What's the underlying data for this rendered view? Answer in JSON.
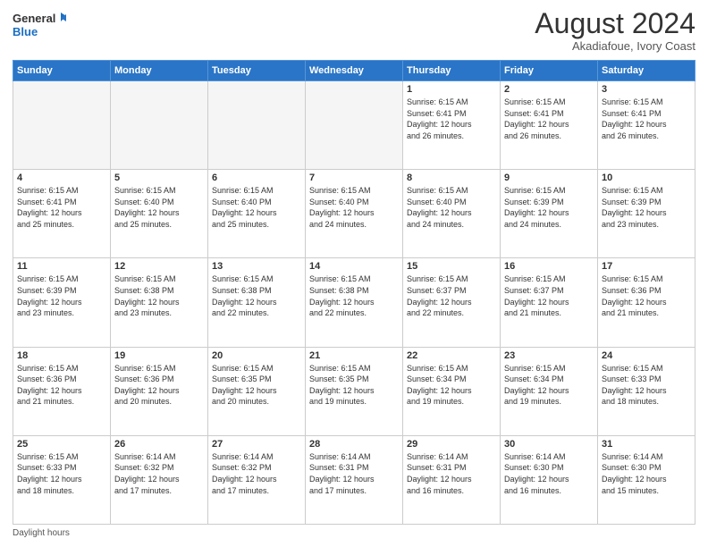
{
  "logo": {
    "line1": "General",
    "line2": "Blue"
  },
  "title": "August 2024",
  "location": "Akadiafoue, Ivory Coast",
  "weekdays": [
    "Sunday",
    "Monday",
    "Tuesday",
    "Wednesday",
    "Thursday",
    "Friday",
    "Saturday"
  ],
  "footer": "Daylight hours",
  "weeks": [
    [
      {
        "day": "",
        "info": ""
      },
      {
        "day": "",
        "info": ""
      },
      {
        "day": "",
        "info": ""
      },
      {
        "day": "",
        "info": ""
      },
      {
        "day": "1",
        "info": "Sunrise: 6:15 AM\nSunset: 6:41 PM\nDaylight: 12 hours\nand 26 minutes."
      },
      {
        "day": "2",
        "info": "Sunrise: 6:15 AM\nSunset: 6:41 PM\nDaylight: 12 hours\nand 26 minutes."
      },
      {
        "day": "3",
        "info": "Sunrise: 6:15 AM\nSunset: 6:41 PM\nDaylight: 12 hours\nand 26 minutes."
      }
    ],
    [
      {
        "day": "4",
        "info": "Sunrise: 6:15 AM\nSunset: 6:41 PM\nDaylight: 12 hours\nand 25 minutes."
      },
      {
        "day": "5",
        "info": "Sunrise: 6:15 AM\nSunset: 6:40 PM\nDaylight: 12 hours\nand 25 minutes."
      },
      {
        "day": "6",
        "info": "Sunrise: 6:15 AM\nSunset: 6:40 PM\nDaylight: 12 hours\nand 25 minutes."
      },
      {
        "day": "7",
        "info": "Sunrise: 6:15 AM\nSunset: 6:40 PM\nDaylight: 12 hours\nand 24 minutes."
      },
      {
        "day": "8",
        "info": "Sunrise: 6:15 AM\nSunset: 6:40 PM\nDaylight: 12 hours\nand 24 minutes."
      },
      {
        "day": "9",
        "info": "Sunrise: 6:15 AM\nSunset: 6:39 PM\nDaylight: 12 hours\nand 24 minutes."
      },
      {
        "day": "10",
        "info": "Sunrise: 6:15 AM\nSunset: 6:39 PM\nDaylight: 12 hours\nand 23 minutes."
      }
    ],
    [
      {
        "day": "11",
        "info": "Sunrise: 6:15 AM\nSunset: 6:39 PM\nDaylight: 12 hours\nand 23 minutes."
      },
      {
        "day": "12",
        "info": "Sunrise: 6:15 AM\nSunset: 6:38 PM\nDaylight: 12 hours\nand 23 minutes."
      },
      {
        "day": "13",
        "info": "Sunrise: 6:15 AM\nSunset: 6:38 PM\nDaylight: 12 hours\nand 22 minutes."
      },
      {
        "day": "14",
        "info": "Sunrise: 6:15 AM\nSunset: 6:38 PM\nDaylight: 12 hours\nand 22 minutes."
      },
      {
        "day": "15",
        "info": "Sunrise: 6:15 AM\nSunset: 6:37 PM\nDaylight: 12 hours\nand 22 minutes."
      },
      {
        "day": "16",
        "info": "Sunrise: 6:15 AM\nSunset: 6:37 PM\nDaylight: 12 hours\nand 21 minutes."
      },
      {
        "day": "17",
        "info": "Sunrise: 6:15 AM\nSunset: 6:36 PM\nDaylight: 12 hours\nand 21 minutes."
      }
    ],
    [
      {
        "day": "18",
        "info": "Sunrise: 6:15 AM\nSunset: 6:36 PM\nDaylight: 12 hours\nand 21 minutes."
      },
      {
        "day": "19",
        "info": "Sunrise: 6:15 AM\nSunset: 6:36 PM\nDaylight: 12 hours\nand 20 minutes."
      },
      {
        "day": "20",
        "info": "Sunrise: 6:15 AM\nSunset: 6:35 PM\nDaylight: 12 hours\nand 20 minutes."
      },
      {
        "day": "21",
        "info": "Sunrise: 6:15 AM\nSunset: 6:35 PM\nDaylight: 12 hours\nand 19 minutes."
      },
      {
        "day": "22",
        "info": "Sunrise: 6:15 AM\nSunset: 6:34 PM\nDaylight: 12 hours\nand 19 minutes."
      },
      {
        "day": "23",
        "info": "Sunrise: 6:15 AM\nSunset: 6:34 PM\nDaylight: 12 hours\nand 19 minutes."
      },
      {
        "day": "24",
        "info": "Sunrise: 6:15 AM\nSunset: 6:33 PM\nDaylight: 12 hours\nand 18 minutes."
      }
    ],
    [
      {
        "day": "25",
        "info": "Sunrise: 6:15 AM\nSunset: 6:33 PM\nDaylight: 12 hours\nand 18 minutes."
      },
      {
        "day": "26",
        "info": "Sunrise: 6:14 AM\nSunset: 6:32 PM\nDaylight: 12 hours\nand 17 minutes."
      },
      {
        "day": "27",
        "info": "Sunrise: 6:14 AM\nSunset: 6:32 PM\nDaylight: 12 hours\nand 17 minutes."
      },
      {
        "day": "28",
        "info": "Sunrise: 6:14 AM\nSunset: 6:31 PM\nDaylight: 12 hours\nand 17 minutes."
      },
      {
        "day": "29",
        "info": "Sunrise: 6:14 AM\nSunset: 6:31 PM\nDaylight: 12 hours\nand 16 minutes."
      },
      {
        "day": "30",
        "info": "Sunrise: 6:14 AM\nSunset: 6:30 PM\nDaylight: 12 hours\nand 16 minutes."
      },
      {
        "day": "31",
        "info": "Sunrise: 6:14 AM\nSunset: 6:30 PM\nDaylight: 12 hours\nand 15 minutes."
      }
    ]
  ]
}
